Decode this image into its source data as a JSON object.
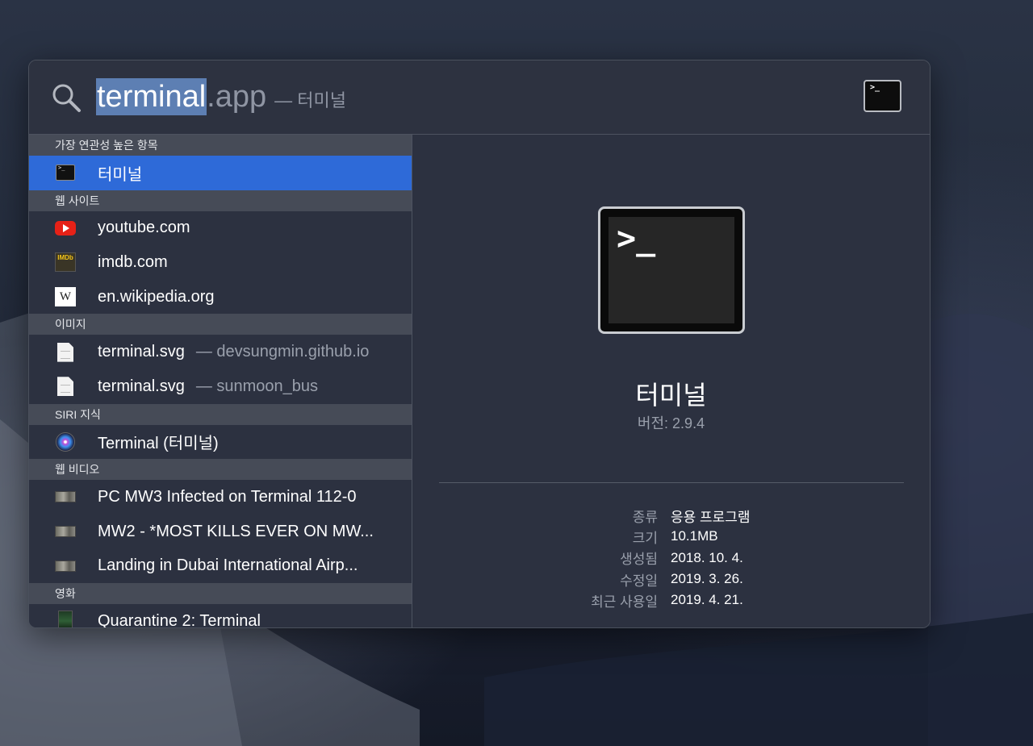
{
  "search": {
    "typed": "terminal",
    "completion": ".app",
    "suffix": "— 터미널"
  },
  "sections": [
    {
      "header": "가장 연관성 높은 항목",
      "items": [
        {
          "label": "터미널",
          "sub": "",
          "icon": "terminal-app-icon",
          "selected": true
        }
      ]
    },
    {
      "header": "웹 사이트",
      "items": [
        {
          "label": "youtube.com",
          "sub": "",
          "icon": "youtube-icon"
        },
        {
          "label": "imdb.com",
          "sub": "",
          "icon": "imdb-icon",
          "icon_text": "IMDb"
        },
        {
          "label": "en.wikipedia.org",
          "sub": "",
          "icon": "wikipedia-icon",
          "icon_text": "W"
        }
      ]
    },
    {
      "header": "이미지",
      "items": [
        {
          "label": "terminal.svg",
          "sub": "— devsungmin.github.io",
          "icon": "document-icon"
        },
        {
          "label": "terminal.svg",
          "sub": "— sunmoon_bus",
          "icon": "document-icon"
        }
      ]
    },
    {
      "header": "SIRI 지식",
      "items": [
        {
          "label": "Terminal (터미널)",
          "sub": "",
          "icon": "siri-icon"
        }
      ]
    },
    {
      "header": "웹 비디오",
      "items": [
        {
          "label": "PC MW3 Infected on Terminal 112-0",
          "sub": "",
          "icon": "video-thumbnail-icon"
        },
        {
          "label": "MW2 - *MOST KILLS EVER ON MW...",
          "sub": "",
          "icon": "video-thumbnail-icon"
        },
        {
          "label": "Landing in Dubai International Airp...",
          "sub": "",
          "icon": "video-thumbnail-icon"
        }
      ]
    },
    {
      "header": "영화",
      "items": [
        {
          "label": "Quarantine 2: Terminal",
          "sub": "",
          "icon": "movie-poster-icon"
        }
      ]
    }
  ],
  "detail": {
    "icon_prompt": ">_",
    "small_icon_prompt": ">_",
    "name": "터미널",
    "version": "버전: 2.9.4",
    "meta": [
      {
        "key": "종류",
        "value": "응용 프로그램"
      },
      {
        "key": "크기",
        "value": "10.1MB"
      },
      {
        "key": "생성됨",
        "value": "2018. 10. 4."
      },
      {
        "key": "수정일",
        "value": "2019. 3. 26."
      },
      {
        "key": "최근 사용일",
        "value": "2019. 4. 21."
      }
    ]
  },
  "colors": {
    "selection": "#2e6ad8",
    "panel": "#2c3140",
    "section_header": "#464b57",
    "query_highlight": "#5d7fb3"
  }
}
